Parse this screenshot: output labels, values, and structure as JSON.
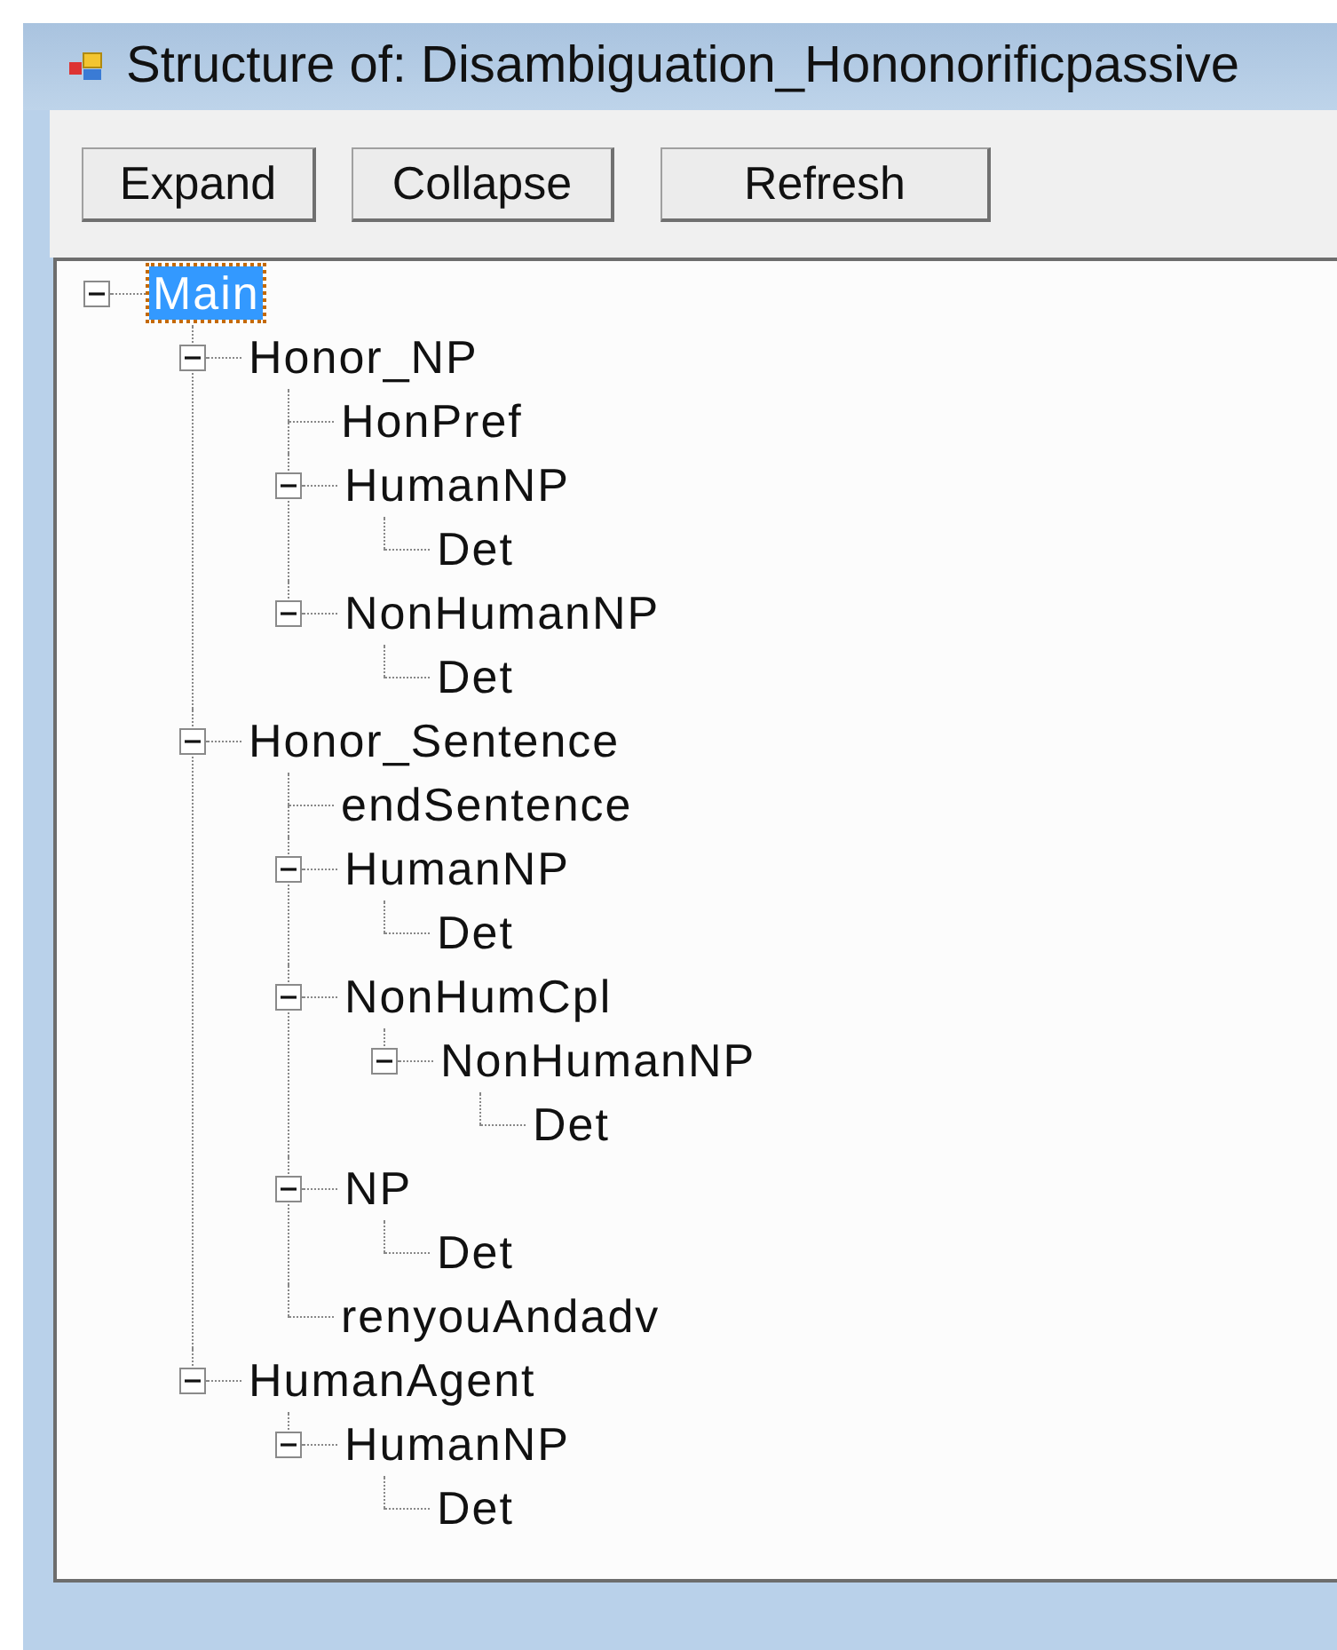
{
  "window": {
    "title": "Structure of: Disambiguation_Hononorificpassive"
  },
  "buttons": [
    {
      "label": "Expand"
    },
    {
      "label": "Collapse"
    },
    {
      "label": "Refresh"
    }
  ],
  "tree": {
    "nodes": [
      {
        "label": "Main",
        "selected": true,
        "expanded": true,
        "children": [
          {
            "label": "Honor_NP",
            "selected": false,
            "expanded": true,
            "children": [
              {
                "label": "HonPref",
                "selected": false
              },
              {
                "label": "HumanNP",
                "selected": false,
                "expanded": true,
                "children": [
                  {
                    "label": "Det",
                    "selected": false
                  }
                ]
              },
              {
                "label": "NonHumanNP",
                "selected": false,
                "expanded": true,
                "children": [
                  {
                    "label": "Det",
                    "selected": false
                  }
                ]
              }
            ]
          },
          {
            "label": "Honor_Sentence",
            "selected": false,
            "expanded": true,
            "children": [
              {
                "label": "endSentence",
                "selected": false
              },
              {
                "label": "HumanNP",
                "selected": false,
                "expanded": true,
                "children": [
                  {
                    "label": "Det",
                    "selected": false
                  }
                ]
              },
              {
                "label": "NonHumCpl",
                "selected": false,
                "expanded": true,
                "children": [
                  {
                    "label": "NonHumanNP",
                    "selected": false,
                    "expanded": true,
                    "children": [
                      {
                        "label": "Det",
                        "selected": false
                      }
                    ]
                  }
                ]
              },
              {
                "label": "NP",
                "selected": false,
                "expanded": true,
                "children": [
                  {
                    "label": "Det",
                    "selected": false
                  }
                ]
              },
              {
                "label": "renyouAndadv",
                "selected": false
              }
            ]
          },
          {
            "label": "HumanAgent",
            "selected": false,
            "expanded": true,
            "children": [
              {
                "label": "HumanNP",
                "selected": false,
                "expanded": true,
                "children": [
                  {
                    "label": "Det",
                    "selected": false
                  }
                ]
              }
            ]
          }
        ]
      }
    ]
  }
}
